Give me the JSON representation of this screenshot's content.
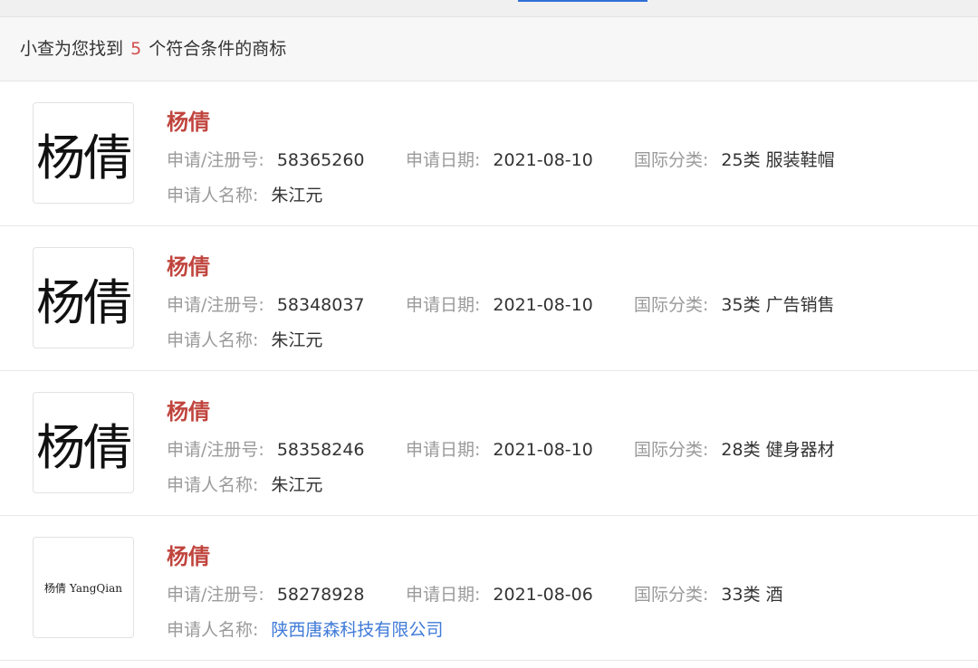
{
  "header": {
    "prefix": "小查为您找到",
    "count": "5",
    "suffix": "个符合条件的商标"
  },
  "colors": {
    "name": "#c0453e",
    "count": "#d24a4a",
    "link": "#3f7ad8",
    "label": "#9a9a9a"
  },
  "labels": {
    "reg_no": "申请/注册号:",
    "apply_date": "申请日期:",
    "intl_class": "国际分类:",
    "applicant": "申请人名称:"
  },
  "results": [
    {
      "logo_text": "杨倩",
      "name": "杨倩",
      "reg_no": "58365260",
      "apply_date": "2021-08-10",
      "intl_class": "25类 服装鞋帽",
      "applicant": "朱江元"
    },
    {
      "logo_text": "杨倩",
      "name": "杨倩",
      "reg_no": "58348037",
      "apply_date": "2021-08-10",
      "intl_class": "35类 广告销售",
      "applicant": "朱江元"
    },
    {
      "logo_text": "杨倩",
      "name": "杨倩",
      "reg_no": "58358246",
      "apply_date": "2021-08-10",
      "intl_class": "28类 健身器材",
      "applicant": "朱江元"
    },
    {
      "logo_text": "杨倩 YangQian",
      "name": "杨倩",
      "reg_no": "58278928",
      "apply_date": "2021-08-06",
      "intl_class": "33类 酒",
      "applicant": "陕西唐森科技有限公司"
    }
  ]
}
